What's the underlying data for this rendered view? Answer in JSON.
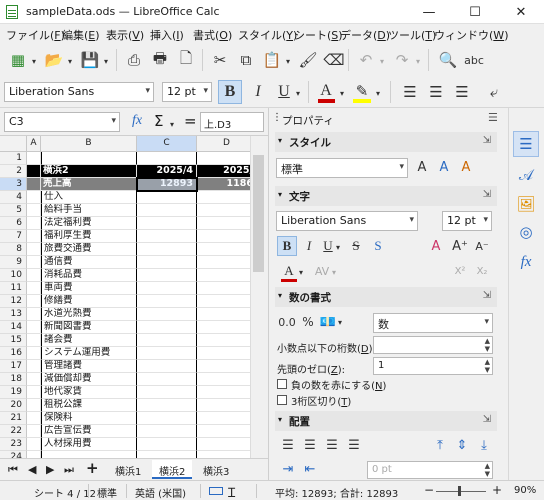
{
  "window": {
    "title": "sampleData.ods — LibreOffice Calc",
    "minimize": "—",
    "maximize": "☐",
    "close": "✕"
  },
  "menu": [
    {
      "label": "ファイル(",
      "key": "F",
      "end": ")"
    },
    {
      "label": "編集(",
      "key": "E",
      "end": ")"
    },
    {
      "label": "表示(",
      "key": "V",
      "end": ")"
    },
    {
      "label": "挿入(",
      "key": "I",
      "end": ")"
    },
    {
      "label": "書式(",
      "key": "O",
      "end": ")"
    },
    {
      "label": "スタイル(",
      "key": "Y",
      "end": ")"
    },
    {
      "label": "シート(",
      "key": "S",
      "end": ")"
    },
    {
      "label": "データ(",
      "key": "D",
      "end": ")"
    },
    {
      "label": "ツール(",
      "key": "T",
      "end": ")"
    },
    {
      "label": "ウィンドウ(",
      "key": "W",
      "end": ")"
    }
  ],
  "format_toolbar": {
    "font_name": "Liberation Sans",
    "font_size": "12 pt",
    "bold": "B",
    "italic": "I",
    "underline": "U",
    "font_color": "#cc0000",
    "highlight_color": "#ffff00"
  },
  "formula_bar": {
    "name_box": "C3",
    "fx": "fx",
    "sum": "Σ",
    "equals": "=",
    "content": "上.D3"
  },
  "sheet": {
    "columns": [
      "A",
      "B",
      "C",
      "D"
    ],
    "selected_column": "C",
    "selected_row": "3",
    "rows": [
      {
        "n": "1",
        "b": "",
        "c": "",
        "d": "",
        "style": ""
      },
      {
        "n": "2",
        "b": "横浜2",
        "c": "2025/4",
        "d": "2025/",
        "style": "bl"
      },
      {
        "n": "3",
        "b": "売上高",
        "c": "12893",
        "d": "1186",
        "style": "gy"
      },
      {
        "n": "4",
        "b": "仕入",
        "c": "",
        "d": "",
        "style": ""
      },
      {
        "n": "5",
        "b": "給料手当",
        "c": "",
        "d": "",
        "style": ""
      },
      {
        "n": "6",
        "b": "法定福利費",
        "c": "",
        "d": "",
        "style": ""
      },
      {
        "n": "7",
        "b": "福利厚生費",
        "c": "",
        "d": "",
        "style": ""
      },
      {
        "n": "8",
        "b": "旅費交通費",
        "c": "",
        "d": "",
        "style": ""
      },
      {
        "n": "9",
        "b": "通信費",
        "c": "",
        "d": "",
        "style": ""
      },
      {
        "n": "10",
        "b": "消耗品費",
        "c": "",
        "d": "",
        "style": ""
      },
      {
        "n": "11",
        "b": "車両費",
        "c": "",
        "d": "",
        "style": ""
      },
      {
        "n": "12",
        "b": "修繕費",
        "c": "",
        "d": "",
        "style": ""
      },
      {
        "n": "13",
        "b": "水道光熱費",
        "c": "",
        "d": "",
        "style": ""
      },
      {
        "n": "14",
        "b": "新聞図書費",
        "c": "",
        "d": "",
        "style": ""
      },
      {
        "n": "15",
        "b": "諸会費",
        "c": "",
        "d": "",
        "style": ""
      },
      {
        "n": "16",
        "b": "システム運用費",
        "c": "",
        "d": "",
        "style": ""
      },
      {
        "n": "17",
        "b": "管理諸費",
        "c": "",
        "d": "",
        "style": ""
      },
      {
        "n": "18",
        "b": "減価償却費",
        "c": "",
        "d": "",
        "style": ""
      },
      {
        "n": "19",
        "b": "地代家賃",
        "c": "",
        "d": "",
        "style": ""
      },
      {
        "n": "20",
        "b": "租税公課",
        "c": "",
        "d": "",
        "style": ""
      },
      {
        "n": "21",
        "b": "保険料",
        "c": "",
        "d": "",
        "style": ""
      },
      {
        "n": "22",
        "b": "広告宣伝費",
        "c": "",
        "d": "",
        "style": ""
      },
      {
        "n": "23",
        "b": "人材採用費",
        "c": "",
        "d": "",
        "style": ""
      },
      {
        "n": "24",
        "b": "",
        "c": "",
        "d": "",
        "style": ""
      }
    ],
    "tabs": [
      "横浜1",
      "横浜2",
      "横浜3"
    ],
    "active_tab": "横浜2",
    "add_tab": "+"
  },
  "sidebar": {
    "header": "プロパティ",
    "styles": {
      "title": "スタイル",
      "value": "標準"
    },
    "character": {
      "title": "文字",
      "font_name": "Liberation Sans",
      "font_size": "12 pt",
      "bold": "B",
      "italic": "I",
      "underline": "U",
      "strike": "S",
      "shadow": "S",
      "superscript": "X²",
      "subscript": "X₂"
    },
    "number_format": {
      "title": "数の書式",
      "percent": "%",
      "category": "数",
      "decimal_label": "小数点以下の桁数(",
      "decimal_key": "D",
      "decimal_value": "",
      "leading_zero_label": "先頭のゼロ(",
      "leading_zero_key": "Z",
      "leading_zero_value": "1",
      "negative_red_label": "負の数を赤にする(",
      "negative_red_key": "N",
      "thousands_label": "3桁区切り(",
      "thousands_key": "T"
    },
    "alignment": {
      "title": "配置",
      "indent_value": "0 pt"
    }
  },
  "status": {
    "sheet": "シート 4 / 12",
    "page_style": "標準",
    "language": "英語 (米国)",
    "summary": "平均: 12893; 合計: 12893",
    "zoom": "90%",
    "zoom_minus": "−",
    "zoom_plus": "+"
  }
}
